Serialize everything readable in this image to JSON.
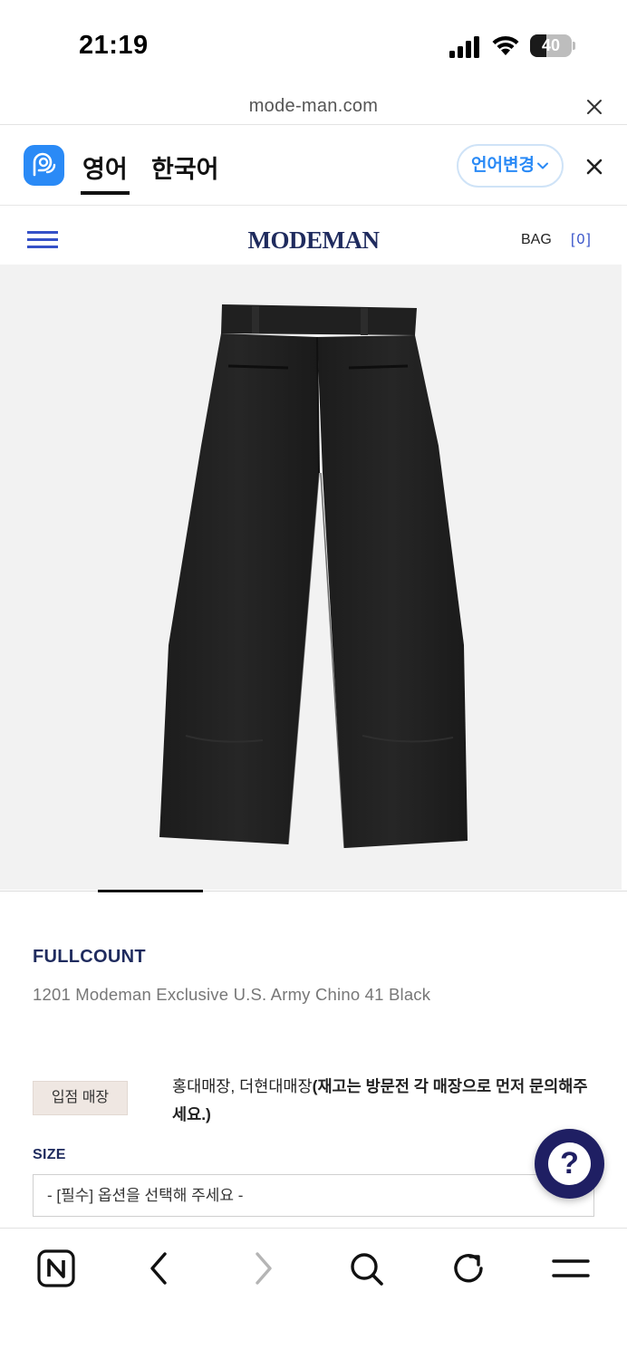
{
  "status_bar": {
    "time": "21:19",
    "battery_level": "40",
    "battery_fraction": 0.4
  },
  "url_bar": {
    "url": "mode-man.com",
    "close_icon": "close-icon"
  },
  "translate_bar": {
    "app_icon": "papago-icon",
    "tabs": [
      {
        "label": "영어",
        "active": true
      },
      {
        "label": "한국어",
        "active": false
      }
    ],
    "change_language_label": "언어변경",
    "accent_color": "#2a8af6"
  },
  "site_header": {
    "menu_icon": "hamburger-icon",
    "logo": "MODEMAN",
    "bag_label": "BAG",
    "bag_count": "[0]",
    "brand_color": "#1f2b5e"
  },
  "product": {
    "image": "black-chino-pants",
    "brand": "FULLCOUNT",
    "name": "1201 Modeman Exclusive U.S. Army Chino 41 Black",
    "store_badge": "입점 매장",
    "store_text_normal": "홍대매장, 더현대매장",
    "store_text_bold": "(재고는 방문전 각 매장으로 먼저 문의해주세요.)",
    "size_label": "SIZE",
    "size_placeholder": "- [필수] 옵션을 선택해 주세요 -"
  },
  "help_button": {
    "label": "?"
  },
  "toolbar": {
    "items": [
      "naver-home-icon",
      "back-icon",
      "forward-icon",
      "search-icon",
      "reload-icon",
      "menu-icon"
    ]
  }
}
